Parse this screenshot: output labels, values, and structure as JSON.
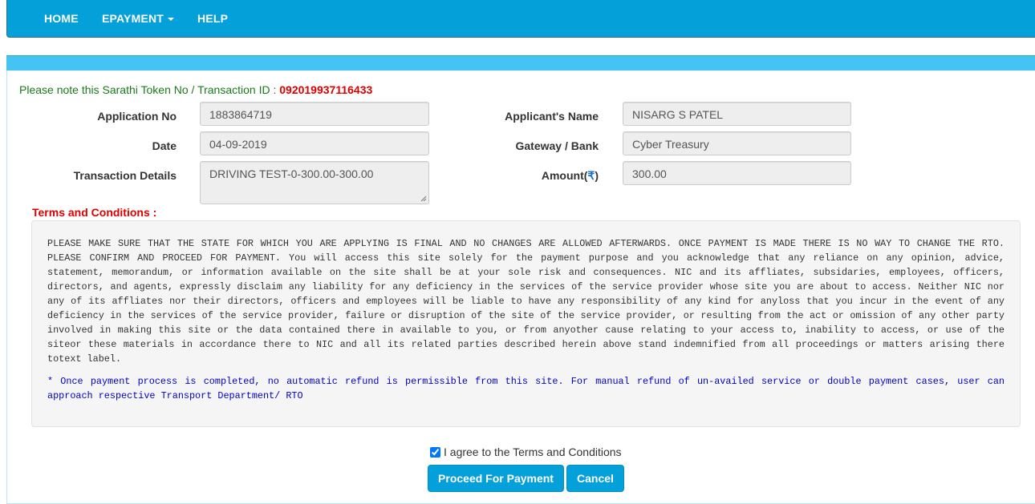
{
  "nav": {
    "home": "HOME",
    "epayment": "EPAYMENT",
    "help": "HELP"
  },
  "token": {
    "prefix": "Please note this Sarathi Token No / Transaction ID : ",
    "value": "092019937116433"
  },
  "form": {
    "application_no_label": "Application No",
    "application_no": "1883864719",
    "date_label": "Date",
    "date": "04-09-2019",
    "transaction_label": "Transaction Details",
    "transaction": "DRIVING TEST-0-300.00-300.00",
    "applicant_name_label": "Applicant's Name",
    "applicant_name": "NISARG S PATEL",
    "gateway_label": "Gateway / Bank",
    "gateway": "Cyber Treasury",
    "amount_label": "Amount(",
    "amount_symbol": "₹",
    "amount_label_end": ")",
    "amount": "300.00"
  },
  "terms": {
    "title": "Terms and Conditions :",
    "body": "PLEASE MAKE SURE THAT THE STATE FOR WHICH YOU ARE APPLYING IS FINAL AND NO CHANGES ARE ALLOWED AFTERWARDS. ONCE PAYMENT IS MADE THERE IS NO WAY TO CHANGE THE RTO. PLEASE CONFIRM AND PROCEED FOR PAYMENT. You will access this site solely for the payment purpose and you acknowledge that any reliance on any opinion, advice, statement, memorandum, or information available on the site shall be at your sole risk and consequences. NIC and its affliates, subsidaries, employees, officers, directors, and agents, expressly disclaim any liability for any deficiency in the services of the service provider whose site you are about to access. Neither NIC nor any of its affliates nor their directors, officers and employees will be liable to have any responsibility of any kind for anyloss that you incur in the event of any deficiency in the services of the service provider, failure or disruption of the site of the service provider, or resulting from the act or omission of any other party involved in making this site or the data contained there in available to you, or from anyother cause relating to your access to, inability to access, or use of the siteor these materials in accordance there to NIC and all its related parties described herein above stand indemnified from all proceedings or matters arising there totext label.",
    "refund_note": "* Once payment process is completed, no automatic refund is permissible from this site. For manual refund of un-availed service or double payment cases, user can approach respective Transport Department/ RTO"
  },
  "agree_label": "I agree to the Terms and Conditions",
  "agree_checked": true,
  "buttons": {
    "proceed": "Proceed For Payment",
    "cancel": "Cancel"
  },
  "colors": {
    "accent": "#03a0da",
    "panel_header": "#45c3f3",
    "token_text": "#1a7a1a",
    "highlight_red": "#dd0000",
    "refund_text": "#0000cc"
  }
}
